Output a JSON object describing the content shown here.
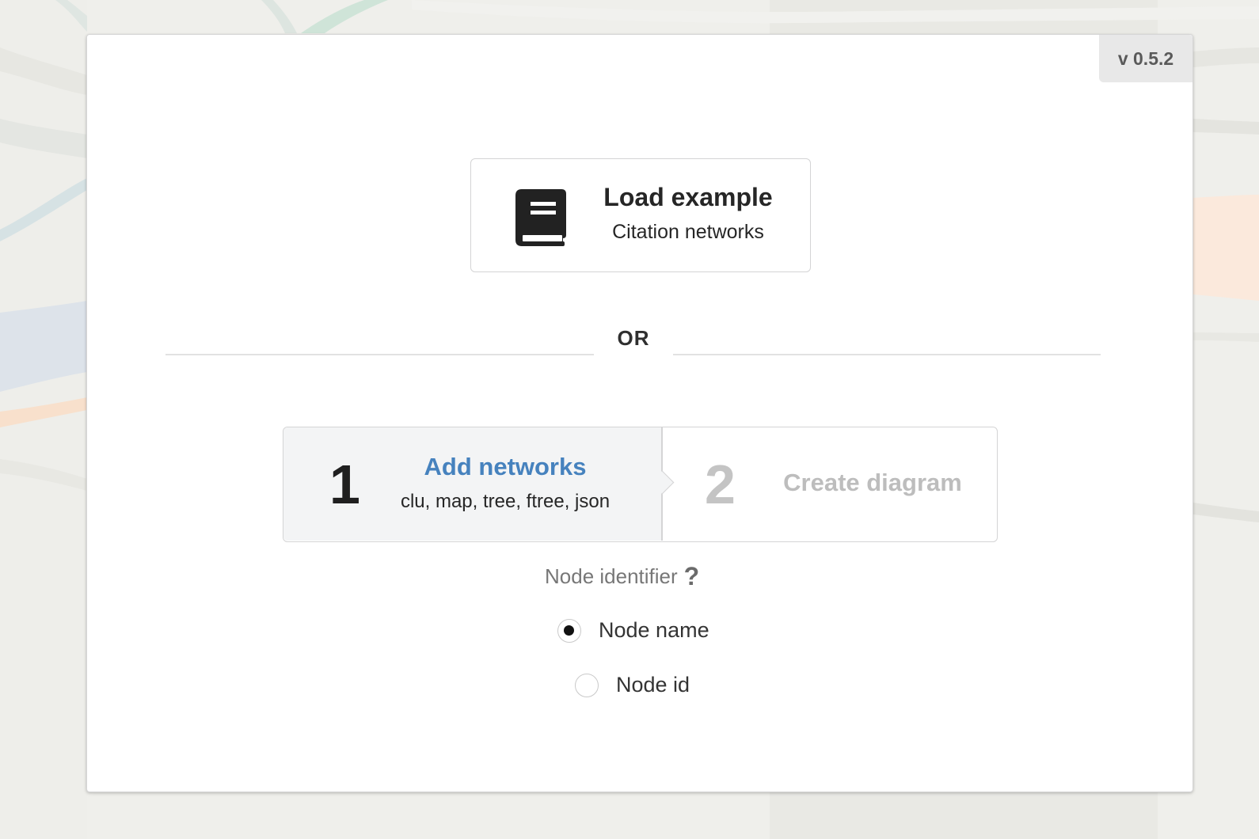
{
  "version": "v 0.5.2",
  "load_example": {
    "icon": "book-icon",
    "title": "Load example",
    "subtitle": "Citation networks"
  },
  "divider": {
    "text": "OR"
  },
  "steps": [
    {
      "number": "1",
      "label": "Add networks",
      "description": "clu, map, tree, ftree, json",
      "active": true
    },
    {
      "number": "2",
      "label": "Create diagram",
      "active": false
    }
  ],
  "node_identifier": {
    "label": "Node identifier",
    "help_icon": "question-mark-icon",
    "options": [
      {
        "label": "Node name",
        "selected": true
      },
      {
        "label": "Node id",
        "selected": false
      }
    ]
  },
  "colors": {
    "accent": "#4682be",
    "step_active_bg": "#f3f4f5",
    "step_inactive_text": "#bdbdbd"
  }
}
